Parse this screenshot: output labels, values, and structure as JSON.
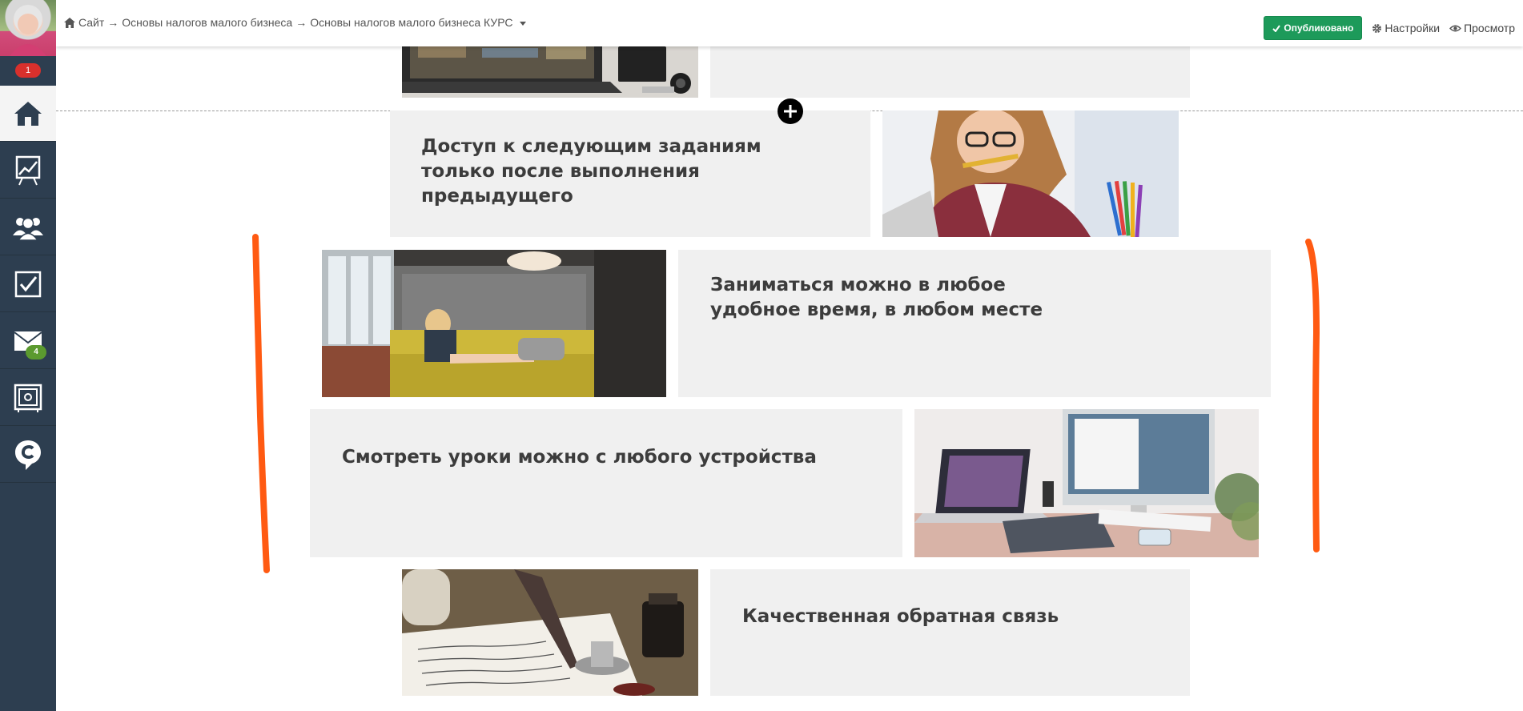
{
  "sidebar": {
    "notification_count": "1",
    "items": [
      {
        "name": "home",
        "icon": "home-icon",
        "active": true
      },
      {
        "name": "stats",
        "icon": "chart-board-icon"
      },
      {
        "name": "users",
        "icon": "users-icon"
      },
      {
        "name": "tasks",
        "icon": "checkbox-icon"
      },
      {
        "name": "messages",
        "icon": "mail-icon",
        "badge": "4"
      },
      {
        "name": "safe",
        "icon": "safe-icon"
      },
      {
        "name": "chat",
        "icon": "chat-c-icon"
      }
    ]
  },
  "breadcrumb": {
    "items": [
      "Сайт",
      "Основы налогов малого бизнеса",
      "Основы налогов малого бизнеса КУРС"
    ],
    "separator": "→"
  },
  "actions": {
    "published_label": "Опубликовано",
    "settings_label": "Настройки",
    "preview_label": "Просмотр"
  },
  "blocks": {
    "access_title": "Доступ к следующим заданиям только после выполнения предыдущего",
    "anytime_title": "Заниматься можно в любое удобное время, в любом месте",
    "devices_title": "Смотреть уроки можно с любого устройства",
    "feedback_title": "Качественная обратная связь"
  },
  "colors": {
    "sidebar_bg": "#2d3e50",
    "published_green": "#1d9a5a",
    "block_bg": "#f0f0f0",
    "annotation_orange": "#ff5a12"
  }
}
